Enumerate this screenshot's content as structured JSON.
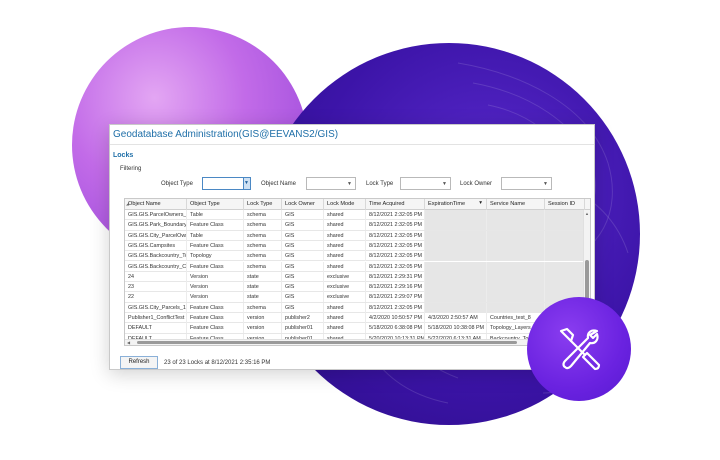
{
  "window": {
    "title": "Geodatabase Administration(GIS@EEVANS2/GIS)",
    "section": "Locks"
  },
  "filtering": {
    "title": "Filtering",
    "object_type_label": "Object Type",
    "object_name_label": "Object Name",
    "lock_type_label": "Lock Type",
    "lock_owner_label": "Lock Owner",
    "object_type_value": "",
    "object_name_value": "",
    "lock_type_value": "",
    "lock_owner_value": ""
  },
  "grid": {
    "columns": [
      "Object Name",
      "Object Type",
      "Lock Type",
      "Lock Owner",
      "Lock Mode",
      "Time Acquired",
      "ExpirationTime",
      "Service Name",
      "Session ID"
    ],
    "sort_indicator": "▾",
    "rows": [
      [
        "GIS.GIS.ParcelOwners_1",
        "Table",
        "schema",
        "GIS",
        "shared",
        "8/12/2021 2:32:05 PM",
        "",
        "",
        ""
      ],
      [
        "GIS.GIS.Park_Boundary",
        "Feature Class",
        "schema",
        "GIS",
        "shared",
        "8/12/2021 2:32:05 PM",
        "",
        "",
        ""
      ],
      [
        "GIS.GIS.City_ParcelOwn",
        "Table",
        "schema",
        "GIS",
        "shared",
        "8/12/2021 2:32:05 PM",
        "",
        "",
        ""
      ],
      [
        "GIS.GIS.Campsites",
        "Feature Class",
        "schema",
        "GIS",
        "shared",
        "8/12/2021 2:32:05 PM",
        "",
        "",
        ""
      ],
      [
        "GIS.GIS.Backcountry_To",
        "Topology",
        "schema",
        "GIS",
        "shared",
        "8/12/2021 2:32:05 PM",
        "",
        "",
        ""
      ],
      [
        "GIS.GIS.Backcountry_Ca",
        "Feature Class",
        "schema",
        "GIS",
        "shared",
        "8/12/2021 2:32:05 PM",
        "",
        "",
        ""
      ],
      [
        "24",
        "Version",
        "state",
        "GIS",
        "exclusive",
        "8/12/2021 2:29:31 PM",
        "",
        "",
        ""
      ],
      [
        "23",
        "Version",
        "state",
        "GIS",
        "exclusive",
        "8/12/2021 2:29:16 PM",
        "",
        "",
        ""
      ],
      [
        "22",
        "Version",
        "state",
        "GIS",
        "exclusive",
        "8/12/2021 2:29:07 PM",
        "",
        "",
        ""
      ],
      [
        "GIS.GIS.City_Parcels_1",
        "Feature Class",
        "schema",
        "GIS",
        "shared",
        "8/12/2021 2:32:05 PM",
        "",
        "",
        ""
      ],
      [
        "Publisher1_ConflictTest",
        "Feature Class",
        "version",
        "publisher2",
        "shared",
        "4/2/2020 10:50:57 PM",
        "4/3/2020 2:50:57 AM",
        "Countries_test_8",
        ""
      ],
      [
        "DEFAULT",
        "Feature Class",
        "version",
        "publisher01",
        "shared",
        "5/18/2020 6:38:08 PM",
        "5/18/2020 10:38:08 PM",
        "Topology_Layers",
        ""
      ],
      [
        "DEFAULT",
        "Feature Class",
        "version",
        "publisher01",
        "shared",
        "5/20/2020 10:13:31 PM",
        "5/22/2020 6:13:31 AM",
        "Backcountry_To",
        ""
      ]
    ]
  },
  "footer": {
    "refresh_label": "Refresh",
    "status": "23 of 23 Locks at 8/12/2021 2:35:16 PM"
  },
  "colors": {
    "accent": "#1f6fa8",
    "badge": "#6a22e0",
    "circle_pink": "#c26be8",
    "circle_purple": "#3c14a8"
  },
  "icons": [
    "wrench-screwdriver-icon",
    "chevron-down-icon"
  ]
}
